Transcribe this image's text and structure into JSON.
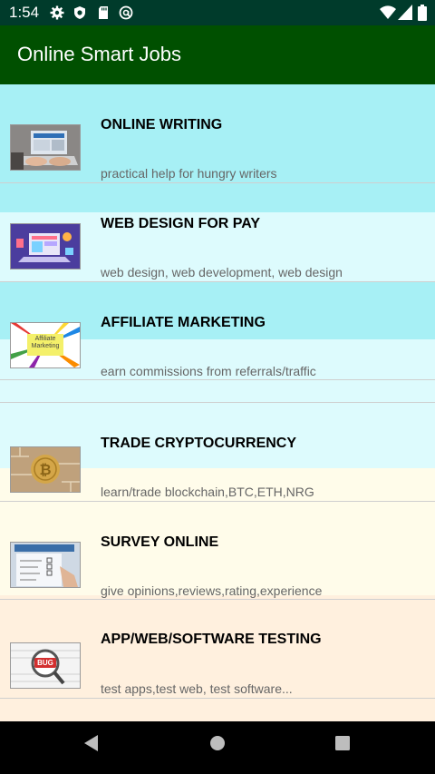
{
  "status_bar": {
    "time": "1:54",
    "left_icons": [
      "gear-icon",
      "shield-icon",
      "sd-card-icon",
      "circle-a-icon"
    ],
    "right_icons": [
      "wifi-icon",
      "signal-icon",
      "battery-icon"
    ]
  },
  "app_bar": {
    "title": "Online Smart Jobs",
    "color": "#005000"
  },
  "list": {
    "items": [
      {
        "title": "ONLINE WRITING",
        "subtitle": "practical help for hungry writers",
        "thumb": "laptop-typing-image"
      },
      {
        "title": "WEB DESIGN FOR PAY",
        "subtitle": "web design, web development, web design",
        "thumb": "web-design-illustration-image"
      },
      {
        "title": "AFFILIATE MARKETING",
        "subtitle": "earn commissions from referrals/traffic",
        "thumb": "affiliate-marketing-image",
        "thumb_text": "Affiliate Marketing"
      },
      {
        "title": "TRADE CRYPTOCURRENCY",
        "subtitle": "learn/trade blockchain,BTC,ETH,NRG",
        "thumb": "bitcoin-coin-image"
      },
      {
        "title": "SURVEY ONLINE",
        "subtitle": "give opinions,reviews,rating,experience",
        "thumb": "survey-form-image"
      },
      {
        "title": "APP/WEB/SOFTWARE TESTING",
        "subtitle": "test apps,test web, test software...",
        "thumb": "bug-magnifier-image",
        "thumb_text": "BUG"
      }
    ]
  },
  "colors": {
    "cyan_band": "#a7f0f5",
    "light_cyan_band": "#ddfbfd",
    "cream_band": "#fffcea",
    "peach_band": "#fff0de"
  },
  "nav_bar": {
    "buttons": [
      "back-icon",
      "home-icon",
      "recents-icon"
    ]
  }
}
